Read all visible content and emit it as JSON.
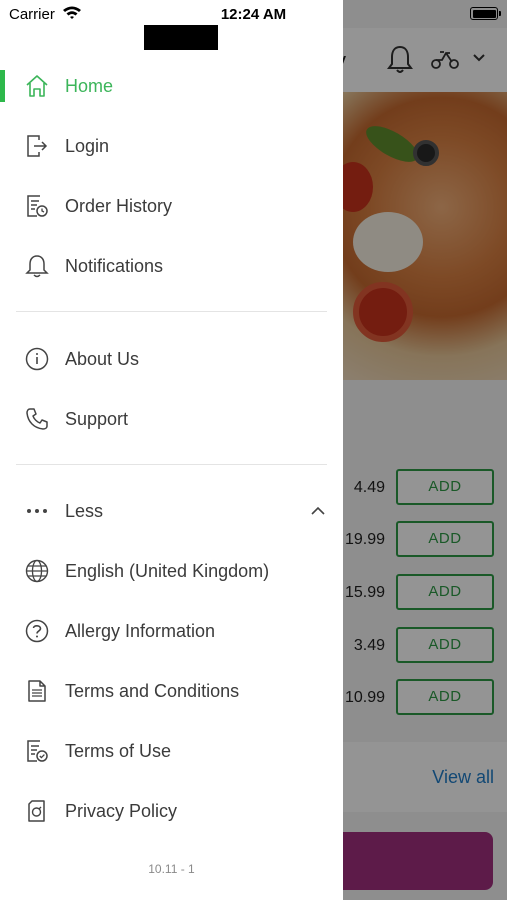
{
  "status_bar": {
    "carrier": "Carrier",
    "time": "12:24 AM"
  },
  "background": {
    "title_fragment": "y",
    "prices": [
      "4.49",
      "19.99",
      "15.99",
      "3.49",
      "10.99"
    ],
    "add_label": "ADD",
    "view_all": "View all"
  },
  "drawer": {
    "items_top": [
      {
        "label": "Home",
        "icon": "home-icon",
        "active": true
      },
      {
        "label": "Login",
        "icon": "login-icon"
      },
      {
        "label": "Order History",
        "icon": "order-history-icon"
      },
      {
        "label": "Notifications",
        "icon": "bell-icon"
      }
    ],
    "items_mid": [
      {
        "label": "About Us",
        "icon": "info-icon"
      },
      {
        "label": "Support",
        "icon": "phone-icon"
      }
    ],
    "less_label": "Less",
    "items_more": [
      {
        "label": "English (United Kingdom)",
        "icon": "globe-icon"
      },
      {
        "label": "Allergy Information",
        "icon": "question-icon"
      },
      {
        "label": "Terms and Conditions",
        "icon": "document-icon"
      },
      {
        "label": "Terms of Use",
        "icon": "document-check-icon"
      },
      {
        "label": "Privacy Policy",
        "icon": "privacy-icon"
      }
    ],
    "version": "10.11 - 1",
    "accent_color": "#3cb55a"
  }
}
